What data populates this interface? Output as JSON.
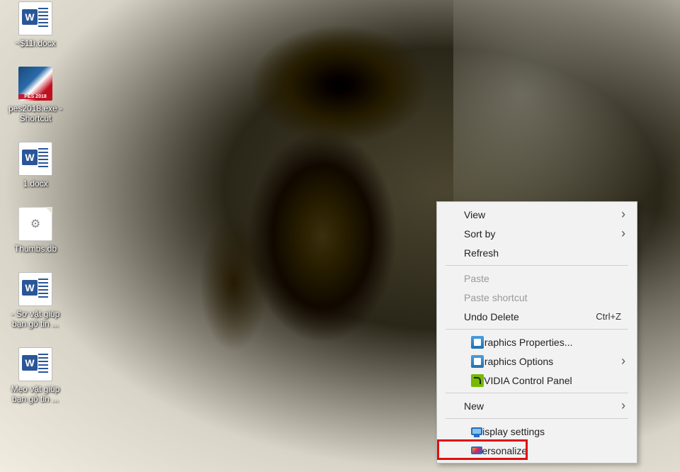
{
  "desktop": {
    "icons": [
      {
        "type": "word",
        "label": "~$11i.docx"
      },
      {
        "type": "pes",
        "label": "pes2018.exe - Shortcut"
      },
      {
        "type": "word",
        "label": "1.docx"
      },
      {
        "type": "file",
        "label": "Thumbs.db"
      },
      {
        "type": "word",
        "label": "- Sơ vật giúp bạn gõ tin ..."
      },
      {
        "type": "word",
        "label": "Mẹo vặt giúp bạn gõ tin ..."
      }
    ]
  },
  "context_menu": {
    "items": [
      {
        "label": "View",
        "submenu": true
      },
      {
        "label": "Sort by",
        "submenu": true
      },
      {
        "label": "Refresh"
      },
      {
        "sep": true
      },
      {
        "label": "Paste",
        "disabled": true
      },
      {
        "label": "Paste shortcut",
        "disabled": true
      },
      {
        "label": "Undo Delete",
        "shortcut": "Ctrl+Z"
      },
      {
        "sep": true
      },
      {
        "label": "Graphics Properties...",
        "icon": "intel"
      },
      {
        "label": "Graphics Options",
        "icon": "intel",
        "submenu": true
      },
      {
        "label": "NVIDIA Control Panel",
        "icon": "nvidia"
      },
      {
        "sep": true
      },
      {
        "label": "New",
        "submenu": true
      },
      {
        "sep": true
      },
      {
        "label": "Display settings",
        "icon": "monitor"
      },
      {
        "label": "Personalize",
        "icon": "personalize",
        "highlighted": true
      }
    ]
  }
}
